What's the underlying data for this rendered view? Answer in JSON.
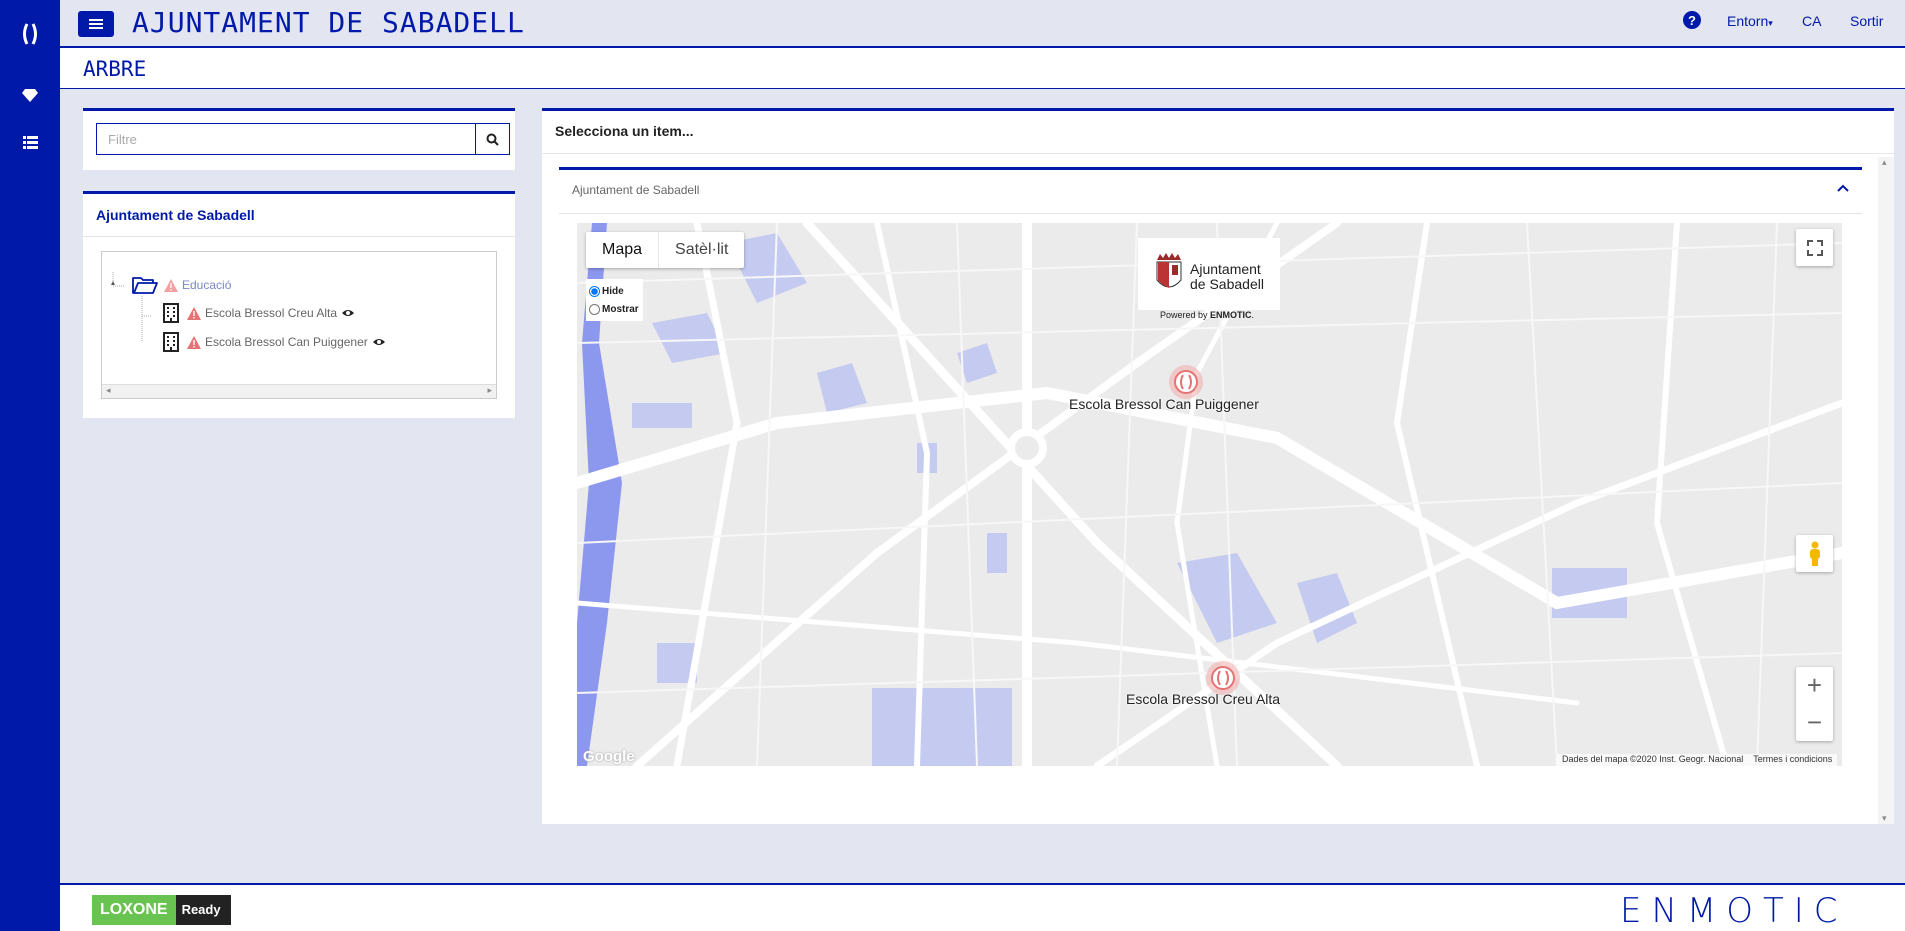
{
  "header": {
    "app_title": "AJUNTAMENT DE SABADELL",
    "entorn_label": "Entorn",
    "lang_label": "CA",
    "logout_label": "Sortir"
  },
  "page": {
    "title": "ARBRE"
  },
  "filter": {
    "placeholder": "Filtre"
  },
  "tree": {
    "heading": "Ajuntament de Sabadell",
    "root": {
      "label": "Educació"
    },
    "children": [
      {
        "label": "Escola Bressol Creu Alta"
      },
      {
        "label": "Escola Bressol Can Puiggener"
      }
    ]
  },
  "main": {
    "heading": "Selecciona un item...",
    "section_title": "Ajuntament de Sabadell"
  },
  "map": {
    "type_buttons": [
      "Mapa",
      "Satèl·lit"
    ],
    "radio_hide": "Hide",
    "radio_show": "Mostrar",
    "logo_line1": "Ajuntament",
    "logo_line2": "de Sabadell",
    "powered_prefix": "Powered by ",
    "powered_brand": "ENMOTIC",
    "powered_suffix": ".",
    "markers": [
      {
        "label": "Escola Bressol Can Puiggener"
      },
      {
        "label": "Escola Bressol Creu Alta"
      }
    ],
    "google_label": "Google",
    "attribution": "Dades del mapa ©2020 Inst. Geogr. Nacional",
    "terms": "Termes i condicions",
    "zoom_in": "+",
    "zoom_out": "−"
  },
  "footer": {
    "loxone_left": "LOXONE",
    "loxone_right": "Ready",
    "brand": "ENMOTIC"
  },
  "colors": {
    "primary": "#0019a8",
    "background": "#e3e6f1",
    "warning": "#e57373",
    "water": "#c5cbf0"
  }
}
